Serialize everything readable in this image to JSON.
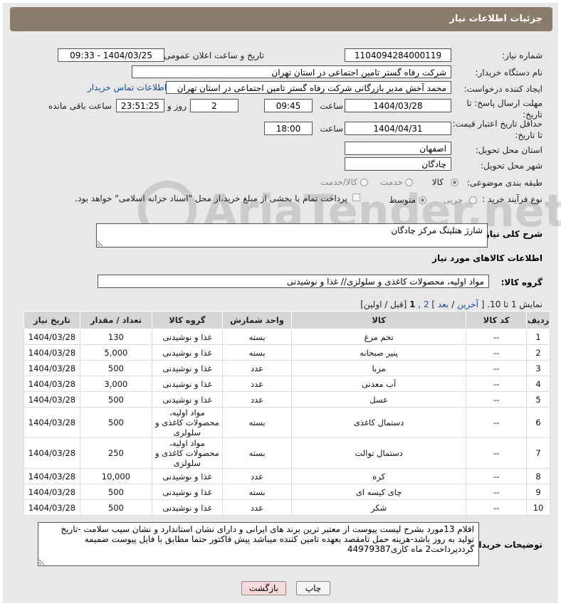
{
  "panel_title": "جزئیات اطلاعات نیاز",
  "fields": {
    "need_number_label": "شماره نیاز:",
    "need_number": "1104094284000119",
    "announce_label": "تاریخ و ساعت اعلان عمومی:",
    "announce_value": "1404/03/25 - 09:33",
    "buyer_org_label": "نام دستگاه خریدار:",
    "buyer_org": "شرکت رفاه گستر تامین اجتماعی در استان تهران",
    "requester_label": "ایجاد کننده درخواست:",
    "requester": "محمد آخش مدیر بازرگانی شرکت رفاه گستر تامین اجتماعی در استان تهران",
    "contact_link": "اطلاعات تماس خریدار",
    "deadline_label_1": "مهلت ارسال پاسخ: تا",
    "deadline_label_2": "تاریخ:",
    "deadline_date": "1404/03/28",
    "time_label": "ساعت",
    "deadline_time": "09:45",
    "days_value": "2",
    "days_label": "روز و",
    "remaining_time": "23:51:25",
    "remaining_label": "ساعت باقی مانده",
    "validity_label_1": "حداقل تاریخ اعتبار قیمت:",
    "validity_label_2": "تا تاریخ:",
    "validity_date": "1404/04/31",
    "validity_time": "18:00",
    "province_label": "استان محل تحویل:",
    "province": "اصفهان",
    "city_label": "شهر محل تحویل:",
    "city": "چادگان",
    "category_label": "طبقه بندی موضوعی:",
    "category_options": [
      "کالا",
      "خدمت",
      "کالا/خدمت"
    ],
    "process_label": "نوع فرآیند خرید :",
    "process_options": [
      "جزیی",
      "متوسط"
    ],
    "payment_note": "پرداخت تمام یا بخشی از مبلغ خرید،از محل \"اسناد خزانه اسلامی\" خواهد بود."
  },
  "description": {
    "label": "شرح کلی نیاز:",
    "value": "شارژ هتلینگ مرکز چادگان"
  },
  "goods_section_title": "اطلاعات کالاهای مورد نیاز",
  "goods_group": {
    "label": "گروه کالا:",
    "value": "مواد اولیه، محصولات کاغذی و سلولزی// غذا و نوشیدنی"
  },
  "pagination": {
    "text_before": "نمایش 1 تا 10. [",
    "last": "آخرین",
    "next": "بعد",
    "page2": "2",
    "current": "1",
    "text_after": "[قبل / اولین]"
  },
  "table": {
    "headers": [
      "ردیف",
      "کد کالا",
      "کالا",
      "واحد شمارش",
      "گروه کالا",
      "تعداد / مقدار",
      "تاریخ نیاز"
    ],
    "rows": [
      [
        "1",
        "--",
        "تخم مرغ",
        "بسته",
        "غذا و نوشیدنی",
        "130",
        "1404/03/28"
      ],
      [
        "2",
        "--",
        "پنیر صبحانه",
        "بسته",
        "غذا و نوشیدنی",
        "5,000",
        "1404/03/28"
      ],
      [
        "3",
        "--",
        "مربا",
        "عدد",
        "غذا و نوشیدنی",
        "500",
        "1404/03/28"
      ],
      [
        "4",
        "--",
        "آب معدنی",
        "عدد",
        "غذا و نوشیدنی",
        "3,000",
        "1404/03/28"
      ],
      [
        "5",
        "--",
        "عسل",
        "عدد",
        "غذا و نوشیدنی",
        "500",
        "1404/03/28"
      ],
      [
        "6",
        "--",
        "دستمال کاغذی",
        "بسته",
        "مواد اولیه، محصولات کاغذی و سلولزی",
        "500",
        "1404/03/28"
      ],
      [
        "7",
        "--",
        "دستمال توالت",
        "بسته",
        "مواد اولیه، محصولات کاغذی و سلولزی",
        "250",
        "1404/03/28"
      ],
      [
        "8",
        "--",
        "کره",
        "عدد",
        "غذا و نوشیدنی",
        "10,000",
        "1404/03/28"
      ],
      [
        "9",
        "--",
        "چای کیسه ای",
        "بسته",
        "غذا و نوشیدنی",
        "500",
        "1404/03/28"
      ],
      [
        "10",
        "--",
        "شکر",
        "عدد",
        "غذا و نوشیدنی",
        "500",
        "1404/03/28"
      ]
    ]
  },
  "buyer_notes": {
    "label": "توضیحات خریدار:",
    "value": "اقلام 13مورد بشرح لیست پیوست از معتبر ترین برند های ایرانی و دارای نشان استاندارد و نشان سیب سلامت -تاریخ تولید به روز باشد-هزینه حمل تامقصد بعهده تامین کننده میباشد پیش فاکتور حتما مطابق با فایل پیوست ضمیمه گرددپرداخت2 ماه کاری44979387"
  },
  "buttons": {
    "print": "چاپ",
    "back": "بازگشت"
  },
  "watermark": "AriaTender.net",
  "colors": {
    "header_bg": "#8b7b6a",
    "link": "#1a4fa0",
    "back_button_bg": "#f6d9d9"
  }
}
